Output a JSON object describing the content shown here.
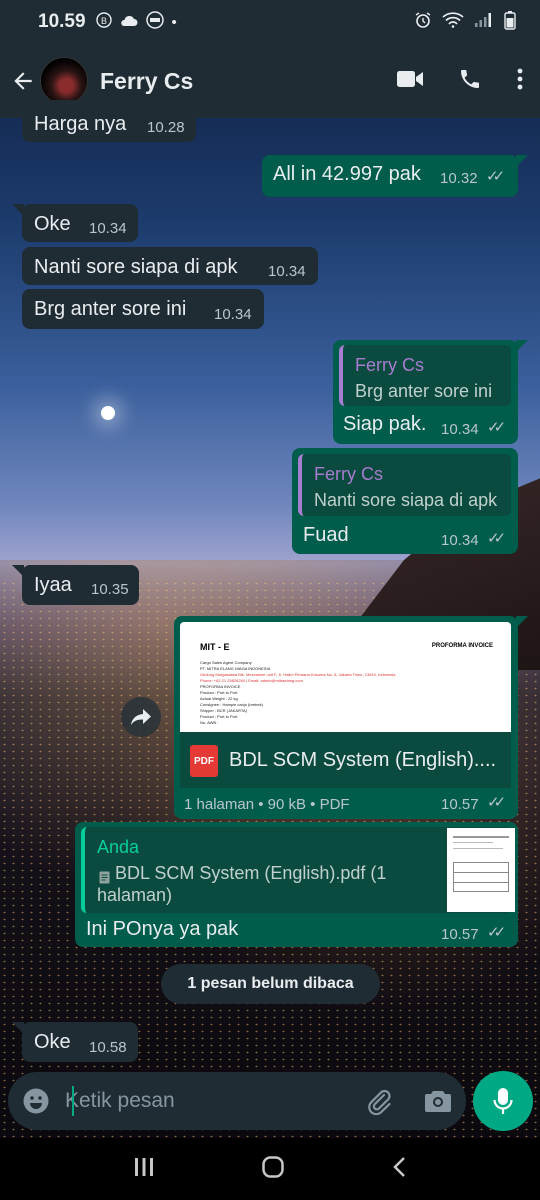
{
  "status_bar": {
    "time": "10.59",
    "icons_left": [
      "b-badge-icon",
      "cloud-icon",
      "media-icon"
    ],
    "icons_right": [
      "alarm-icon",
      "wifi-icon",
      "signal-icon",
      "battery-icon"
    ]
  },
  "header": {
    "contact_name": "Ferry Cs",
    "icons": [
      "back-arrow-icon",
      "video-call-icon",
      "voice-call-icon",
      "more-options-icon"
    ]
  },
  "messages": [
    {
      "direction": "in",
      "text": "Harga nya",
      "time": "10.28"
    },
    {
      "direction": "out",
      "text": "All in 42.997 pak",
      "time": "10.32",
      "status": "read"
    },
    {
      "direction": "in",
      "text": "Oke",
      "time": "10.34"
    },
    {
      "direction": "in",
      "text": "Nanti sore siapa di apk",
      "time": "10.34"
    },
    {
      "direction": "in",
      "text": "Brg anter sore ini",
      "time": "10.34"
    },
    {
      "direction": "out",
      "quote_author": "Ferry Cs",
      "quote_text": "Brg anter sore ini",
      "text": "Siap pak.",
      "time": "10.34",
      "status": "read"
    },
    {
      "direction": "out",
      "quote_author": "Ferry Cs",
      "quote_text": "Nanti sore siapa di apk",
      "text": "Fuad",
      "time": "10.34",
      "status": "read"
    },
    {
      "direction": "in",
      "text": "Iyaa",
      "time": "10.35"
    },
    {
      "direction": "out",
      "type": "document",
      "file_name": "BDL SCM System (English)....",
      "file_meta": "1 halaman • 90 kB • PDF",
      "file_icon_label": "PDF",
      "preview": {
        "logo_text": "MIT - E",
        "heading": "PROFORMA INVOICE",
        "lines": [
          "Cargo Sales Agent Company",
          "PT. MITRA ELANG NIAGA INDONESIA",
          "Gedung Margasatwa Blk. Mezzanine unit F, Jl. Halim Perdana Kusuma No. 6, Jakarta Timur, 13610, Indonesia",
          "Phone: +62 21 29826260 | Email: admin@mitraelang.com",
          "PROFORMA INVOICE",
          "Product : Port to Port",
          "Actual Weight : 22 kg",
          "Consignee : Hampie canjo (brebek)",
          "Shipper : BCR (JAKARTA)",
          "Product : Port to Port",
          "No. AWB :"
        ]
      },
      "time": "10.57",
      "status": "read"
    },
    {
      "direction": "out",
      "quote_author": "Anda",
      "quote_text_line1": "BDL SCM System (English).pdf (1",
      "quote_text_line2": "halaman)",
      "text": "Ini POnya ya pak",
      "time": "10.57",
      "status": "read"
    },
    {
      "direction": "in",
      "text": "Oke",
      "time": "10.58"
    }
  ],
  "unread_banner": "1 pesan belum dibaca",
  "composer": {
    "placeholder": "Ketik pesan",
    "icons": [
      "emoji-icon",
      "attachment-icon",
      "camera-icon",
      "mic-icon"
    ]
  },
  "nav": {
    "icons": [
      "recent-apps-icon",
      "home-icon",
      "back-nav-icon"
    ]
  },
  "colors": {
    "incoming_bubble": "#1f2c34",
    "outgoing_bubble": "#005c4b",
    "accent": "#00a884",
    "quote_name": "#a77dcf",
    "read_ticks": "#b9c6ce"
  }
}
